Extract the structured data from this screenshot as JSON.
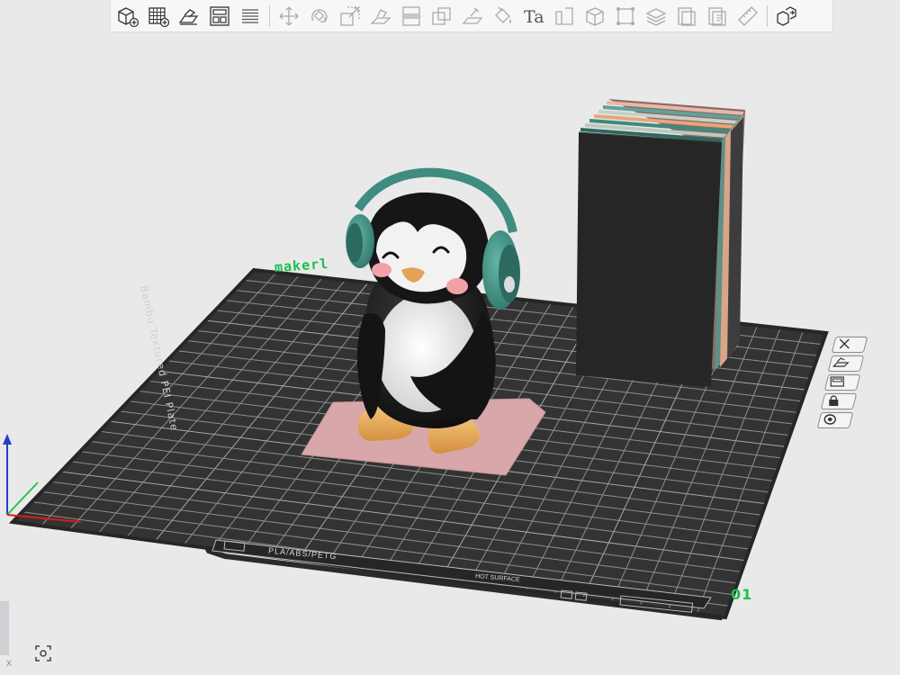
{
  "toolbar": {
    "buttons": [
      {
        "name": "add-object-button",
        "icon": "cube-add-icon"
      },
      {
        "name": "add-plate-button",
        "icon": "grid-add-icon"
      },
      {
        "name": "auto-orient-button",
        "icon": "orient-icon"
      },
      {
        "name": "arrange-button",
        "icon": "arrange-icon"
      },
      {
        "name": "split-view-button",
        "icon": "layers-icon"
      },
      {
        "name": "move-button",
        "icon": "move-icon"
      },
      {
        "name": "rotate-button",
        "icon": "rotate-icon"
      },
      {
        "name": "scale-button",
        "icon": "scale-icon"
      },
      {
        "name": "lay-on-face-button",
        "icon": "lay-on-face-icon"
      },
      {
        "name": "cut-button",
        "icon": "cut-icon"
      },
      {
        "name": "boolean-button",
        "icon": "boolean-icon"
      },
      {
        "name": "support-paint-button",
        "icon": "support-paint-icon"
      },
      {
        "name": "color-paint-button",
        "icon": "paint-bucket-icon"
      },
      {
        "name": "text-button",
        "icon": "text-icon"
      },
      {
        "name": "variable-layer-button",
        "icon": "variable-layer-icon"
      },
      {
        "name": "mesh-boolean-button",
        "icon": "cube-outline-icon"
      },
      {
        "name": "measure-corners-button",
        "icon": "frame-icon"
      },
      {
        "name": "layer-stack-button",
        "icon": "stack-icon"
      },
      {
        "name": "page-button",
        "icon": "page-icon"
      },
      {
        "name": "paste-button",
        "icon": "paste-icon"
      },
      {
        "name": "ruler-button",
        "icon": "ruler-icon"
      },
      {
        "name": "assembly-view-button",
        "icon": "assembly-icon"
      }
    ],
    "text_tool_glyph": "Ta"
  },
  "plate": {
    "brand_text": "makerl",
    "plate_number": "01",
    "plate_name": "Bambu Textured PEI Plate",
    "material_text": "PLA/ABS/PETG",
    "surface_text": "HOT SURFACE"
  },
  "side_controls": [
    {
      "name": "plate-close-button",
      "icon": "close-icon"
    },
    {
      "name": "plate-orient-button",
      "icon": "orient-icon"
    },
    {
      "name": "plate-arrange-button",
      "icon": "arrange-icon"
    },
    {
      "name": "plate-lock-button",
      "icon": "lock-icon"
    },
    {
      "name": "plate-settings-button",
      "icon": "gear-icon"
    }
  ],
  "axes": {
    "x_label": "X"
  },
  "colors": {
    "plate": "#333333",
    "grid": "#8e8e8e",
    "brim": "#d8a7a9",
    "tower": "#262626",
    "headphones": "#4a9c8e",
    "penguin_body": "#161616",
    "penguin_belly": "#f4f4f4",
    "feet": "#e8a85a",
    "brand_green": "#18c24a"
  }
}
